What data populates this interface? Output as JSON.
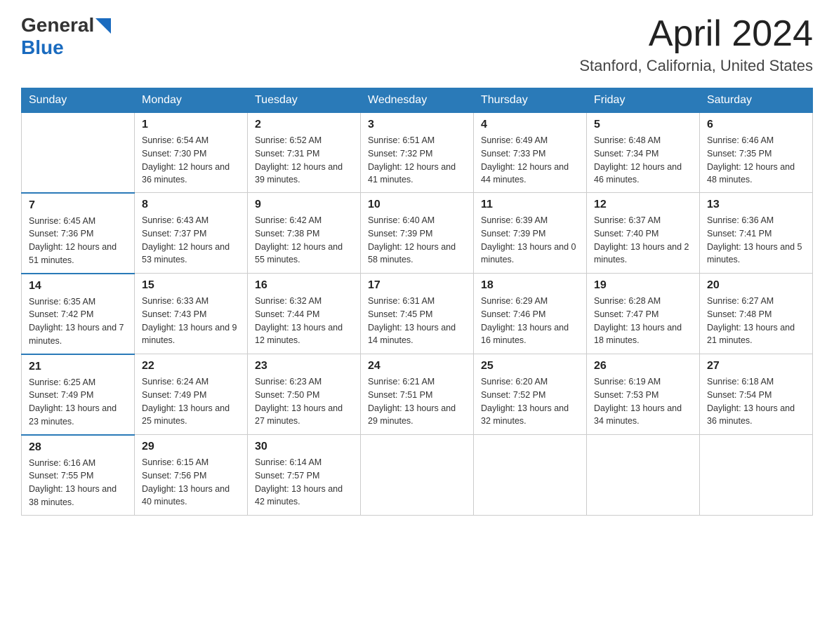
{
  "header": {
    "logo_general": "General",
    "logo_blue": "Blue",
    "month": "April 2024",
    "location": "Stanford, California, United States"
  },
  "weekdays": [
    "Sunday",
    "Monday",
    "Tuesday",
    "Wednesday",
    "Thursday",
    "Friday",
    "Saturday"
  ],
  "weeks": [
    [
      {
        "day": "",
        "sunrise": "",
        "sunset": "",
        "daylight": ""
      },
      {
        "day": "1",
        "sunrise": "Sunrise: 6:54 AM",
        "sunset": "Sunset: 7:30 PM",
        "daylight": "Daylight: 12 hours and 36 minutes."
      },
      {
        "day": "2",
        "sunrise": "Sunrise: 6:52 AM",
        "sunset": "Sunset: 7:31 PM",
        "daylight": "Daylight: 12 hours and 39 minutes."
      },
      {
        "day": "3",
        "sunrise": "Sunrise: 6:51 AM",
        "sunset": "Sunset: 7:32 PM",
        "daylight": "Daylight: 12 hours and 41 minutes."
      },
      {
        "day": "4",
        "sunrise": "Sunrise: 6:49 AM",
        "sunset": "Sunset: 7:33 PM",
        "daylight": "Daylight: 12 hours and 44 minutes."
      },
      {
        "day": "5",
        "sunrise": "Sunrise: 6:48 AM",
        "sunset": "Sunset: 7:34 PM",
        "daylight": "Daylight: 12 hours and 46 minutes."
      },
      {
        "day": "6",
        "sunrise": "Sunrise: 6:46 AM",
        "sunset": "Sunset: 7:35 PM",
        "daylight": "Daylight: 12 hours and 48 minutes."
      }
    ],
    [
      {
        "day": "7",
        "sunrise": "Sunrise: 6:45 AM",
        "sunset": "Sunset: 7:36 PM",
        "daylight": "Daylight: 12 hours and 51 minutes."
      },
      {
        "day": "8",
        "sunrise": "Sunrise: 6:43 AM",
        "sunset": "Sunset: 7:37 PM",
        "daylight": "Daylight: 12 hours and 53 minutes."
      },
      {
        "day": "9",
        "sunrise": "Sunrise: 6:42 AM",
        "sunset": "Sunset: 7:38 PM",
        "daylight": "Daylight: 12 hours and 55 minutes."
      },
      {
        "day": "10",
        "sunrise": "Sunrise: 6:40 AM",
        "sunset": "Sunset: 7:39 PM",
        "daylight": "Daylight: 12 hours and 58 minutes."
      },
      {
        "day": "11",
        "sunrise": "Sunrise: 6:39 AM",
        "sunset": "Sunset: 7:39 PM",
        "daylight": "Daylight: 13 hours and 0 minutes."
      },
      {
        "day": "12",
        "sunrise": "Sunrise: 6:37 AM",
        "sunset": "Sunset: 7:40 PM",
        "daylight": "Daylight: 13 hours and 2 minutes."
      },
      {
        "day": "13",
        "sunrise": "Sunrise: 6:36 AM",
        "sunset": "Sunset: 7:41 PM",
        "daylight": "Daylight: 13 hours and 5 minutes."
      }
    ],
    [
      {
        "day": "14",
        "sunrise": "Sunrise: 6:35 AM",
        "sunset": "Sunset: 7:42 PM",
        "daylight": "Daylight: 13 hours and 7 minutes."
      },
      {
        "day": "15",
        "sunrise": "Sunrise: 6:33 AM",
        "sunset": "Sunset: 7:43 PM",
        "daylight": "Daylight: 13 hours and 9 minutes."
      },
      {
        "day": "16",
        "sunrise": "Sunrise: 6:32 AM",
        "sunset": "Sunset: 7:44 PM",
        "daylight": "Daylight: 13 hours and 12 minutes."
      },
      {
        "day": "17",
        "sunrise": "Sunrise: 6:31 AM",
        "sunset": "Sunset: 7:45 PM",
        "daylight": "Daylight: 13 hours and 14 minutes."
      },
      {
        "day": "18",
        "sunrise": "Sunrise: 6:29 AM",
        "sunset": "Sunset: 7:46 PM",
        "daylight": "Daylight: 13 hours and 16 minutes."
      },
      {
        "day": "19",
        "sunrise": "Sunrise: 6:28 AM",
        "sunset": "Sunset: 7:47 PM",
        "daylight": "Daylight: 13 hours and 18 minutes."
      },
      {
        "day": "20",
        "sunrise": "Sunrise: 6:27 AM",
        "sunset": "Sunset: 7:48 PM",
        "daylight": "Daylight: 13 hours and 21 minutes."
      }
    ],
    [
      {
        "day": "21",
        "sunrise": "Sunrise: 6:25 AM",
        "sunset": "Sunset: 7:49 PM",
        "daylight": "Daylight: 13 hours and 23 minutes."
      },
      {
        "day": "22",
        "sunrise": "Sunrise: 6:24 AM",
        "sunset": "Sunset: 7:49 PM",
        "daylight": "Daylight: 13 hours and 25 minutes."
      },
      {
        "day": "23",
        "sunrise": "Sunrise: 6:23 AM",
        "sunset": "Sunset: 7:50 PM",
        "daylight": "Daylight: 13 hours and 27 minutes."
      },
      {
        "day": "24",
        "sunrise": "Sunrise: 6:21 AM",
        "sunset": "Sunset: 7:51 PM",
        "daylight": "Daylight: 13 hours and 29 minutes."
      },
      {
        "day": "25",
        "sunrise": "Sunrise: 6:20 AM",
        "sunset": "Sunset: 7:52 PM",
        "daylight": "Daylight: 13 hours and 32 minutes."
      },
      {
        "day": "26",
        "sunrise": "Sunrise: 6:19 AM",
        "sunset": "Sunset: 7:53 PM",
        "daylight": "Daylight: 13 hours and 34 minutes."
      },
      {
        "day": "27",
        "sunrise": "Sunrise: 6:18 AM",
        "sunset": "Sunset: 7:54 PM",
        "daylight": "Daylight: 13 hours and 36 minutes."
      }
    ],
    [
      {
        "day": "28",
        "sunrise": "Sunrise: 6:16 AM",
        "sunset": "Sunset: 7:55 PM",
        "daylight": "Daylight: 13 hours and 38 minutes."
      },
      {
        "day": "29",
        "sunrise": "Sunrise: 6:15 AM",
        "sunset": "Sunset: 7:56 PM",
        "daylight": "Daylight: 13 hours and 40 minutes."
      },
      {
        "day": "30",
        "sunrise": "Sunrise: 6:14 AM",
        "sunset": "Sunset: 7:57 PM",
        "daylight": "Daylight: 13 hours and 42 minutes."
      },
      {
        "day": "",
        "sunrise": "",
        "sunset": "",
        "daylight": ""
      },
      {
        "day": "",
        "sunrise": "",
        "sunset": "",
        "daylight": ""
      },
      {
        "day": "",
        "sunrise": "",
        "sunset": "",
        "daylight": ""
      },
      {
        "day": "",
        "sunrise": "",
        "sunset": "",
        "daylight": ""
      }
    ]
  ]
}
